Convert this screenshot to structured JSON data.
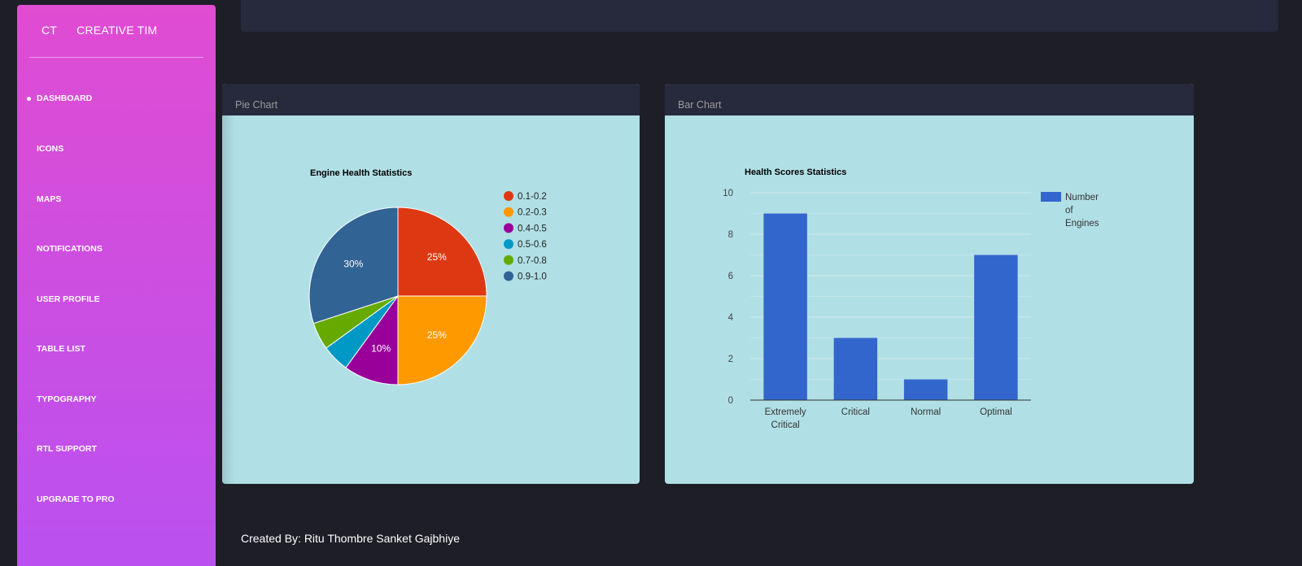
{
  "sidebar": {
    "logo_short": "CT",
    "logo_full": "CREATIVE TIM",
    "items": [
      {
        "label": "DASHBOARD",
        "active": true
      },
      {
        "label": "ICONS"
      },
      {
        "label": "MAPS"
      },
      {
        "label": "NOTIFICATIONS"
      },
      {
        "label": "USER PROFILE"
      },
      {
        "label": "TABLE LIST"
      },
      {
        "label": "TYPOGRAPHY"
      },
      {
        "label": "RTL SUPPORT"
      },
      {
        "label": "UPGRADE TO PRO"
      }
    ]
  },
  "cards": {
    "pie_title": "Pie Chart",
    "bar_title": "Bar Chart"
  },
  "footer": "Created By: Ritu Thombre Sanket Gajbhiye",
  "colors": {
    "sidebar_gradient": [
      "#e04cd2",
      "#ba50f0"
    ],
    "card_bg": "#b0e0e6",
    "header_bg": "#27293d",
    "page_bg": "#1e1e27"
  },
  "chart_data": [
    {
      "type": "pie",
      "title": "Engine Health Statistics",
      "legend_position": "right",
      "slices": [
        {
          "label": "0.1-0.2",
          "value": 25,
          "color": "#dc3912",
          "show_pct": "25%"
        },
        {
          "label": "0.2-0.3",
          "value": 25,
          "color": "#ff9900",
          "show_pct": "25%"
        },
        {
          "label": "0.4-0.5",
          "value": 10,
          "color": "#990099",
          "show_pct": "10%"
        },
        {
          "label": "0.5-0.6",
          "value": 5,
          "color": "#0099c6",
          "show_pct": ""
        },
        {
          "label": "0.7-0.8",
          "value": 5,
          "color": "#66aa00",
          "show_pct": ""
        },
        {
          "label": "0.9-1.0",
          "value": 30,
          "color": "#316395",
          "show_pct": "30%"
        }
      ]
    },
    {
      "type": "bar",
      "title": "Health Scores Statistics",
      "categories": [
        "Extremely Critical",
        "Critical",
        "Normal",
        "Optimal"
      ],
      "series": [
        {
          "name": "Number of Engines",
          "values": [
            9,
            3,
            1,
            7
          ],
          "color": "#3366cc"
        }
      ],
      "ylim": [
        0,
        10
      ],
      "yticks": [
        0,
        2,
        4,
        6,
        8,
        10
      ],
      "grid": true,
      "legend_position": "right"
    }
  ]
}
